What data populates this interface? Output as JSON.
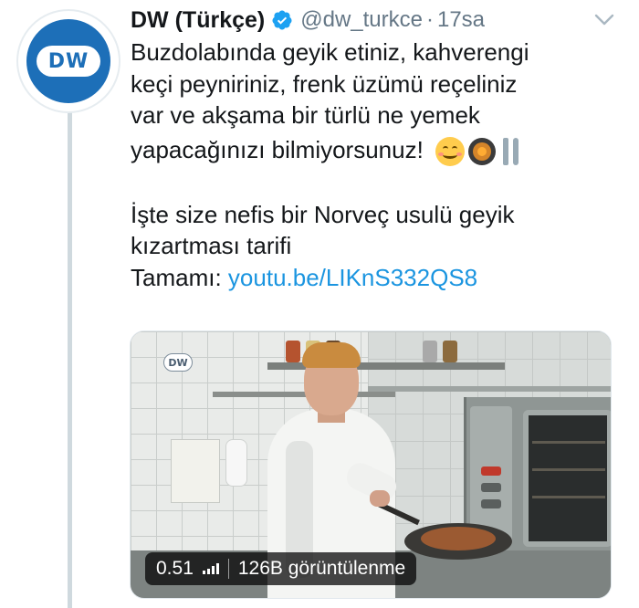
{
  "tweet": {
    "display_name": "DW (Türkçe)",
    "handle": "@dw_turkce",
    "separator": "·",
    "time": "17sa",
    "verified": true,
    "avatar_logo_text": "DW",
    "text_lines": [
      "Buzdolabında geyik etiniz, kahverengi",
      "keçi peyniriniz, frenk üzümü reçeliniz",
      "var ve akşama bir türlü ne yemek",
      "yapacağınızı bilmiyorsunuz!",
      "",
      "İşte size nefis bir Norveç usulü geyik",
      "kızartması tarifi",
      "Tamamı: "
    ],
    "emojis": [
      "smiling-face-emoji",
      "shallow-pan-of-food-emoji",
      "fork-and-knife-emoji"
    ],
    "link": "youtu.be/LIKnS332QS8"
  },
  "media": {
    "duration": "0.51",
    "views": "126B görüntülenme",
    "watermark": "DW"
  },
  "colors": {
    "link": "#1b95e0",
    "secondary_text": "#657786",
    "verified": "#1da1f2",
    "thread_line": "#cfd9de",
    "brand_blue": "#1d6fb8"
  }
}
